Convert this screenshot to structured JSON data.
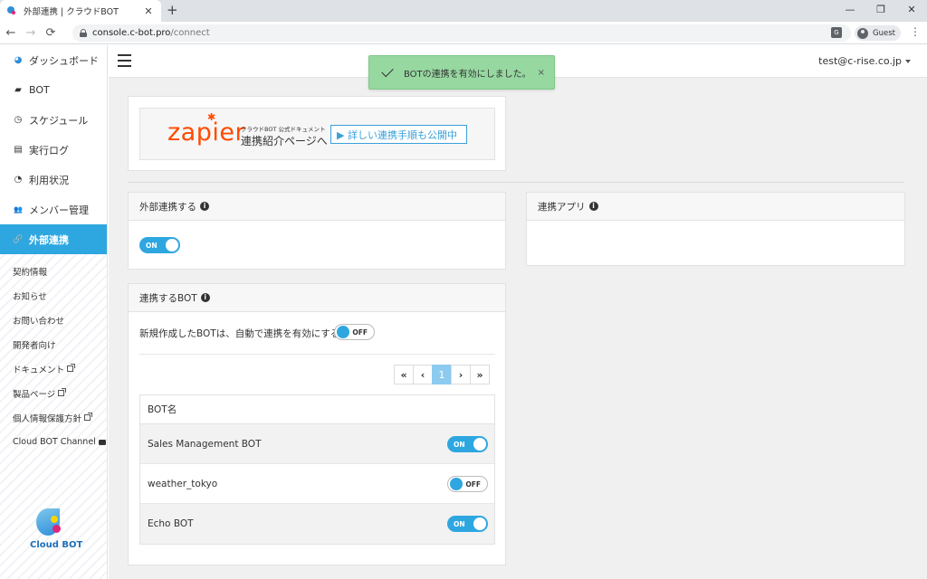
{
  "browser": {
    "tab_title": "外部連携 | クラウドBOT",
    "tab_close": "✕",
    "new_tab": "+",
    "window_min": "—",
    "window_restore": "❐",
    "window_close": "✕",
    "back": "←",
    "forward": "→",
    "reload": "⟳",
    "url_host": "console.c-bot.pro",
    "url_path": "/connect",
    "translate": "G",
    "profile": "Guest",
    "menu": "⋮"
  },
  "sidebar": {
    "items": [
      {
        "label": "ダッシュボード",
        "icon": "logo-icon",
        "glyph": "◕"
      },
      {
        "label": "BOT",
        "icon": "robot-icon",
        "glyph": "▰"
      },
      {
        "label": "スケジュール",
        "icon": "clock-icon",
        "glyph": "◷"
      },
      {
        "label": "実行ログ",
        "icon": "file-icon",
        "glyph": "▤"
      },
      {
        "label": "利用状況",
        "icon": "pie-chart-icon",
        "glyph": "◔"
      },
      {
        "label": "メンバー管理",
        "icon": "users-icon",
        "glyph": "👥"
      },
      {
        "label": "外部連携",
        "icon": "link-icon",
        "glyph": "🔗"
      }
    ],
    "sub_items": [
      {
        "label": "契約情報"
      },
      {
        "label": "お知らせ"
      },
      {
        "label": "お問い合わせ"
      },
      {
        "label": "開発者向け"
      },
      {
        "label": "ドキュメント"
      },
      {
        "label": "製品ページ"
      },
      {
        "label": "個人情報保護方針"
      },
      {
        "label": "Cloud BOT Channel"
      }
    ],
    "logo_text": "Cloud BOT"
  },
  "header": {
    "user_email": "test@c-rise.co.jp"
  },
  "toast": {
    "message": "BOTの連携を有効にしました。",
    "close": "×"
  },
  "banner": {
    "brand": "zapier",
    "star": "✱",
    "small_text": "クラウドBOT 公式ドキュメント",
    "big_text": "連携紹介ページへ",
    "button_text": "▶ 詳しい連携手順も公開中"
  },
  "external": {
    "title": "外部連携する",
    "info": "i",
    "toggle_label": "ON"
  },
  "apps": {
    "title": "連携アプリ",
    "info": "i"
  },
  "bots": {
    "title": "連携するBOT",
    "info": "i",
    "auto_text": "新規作成したBOTは、自動で連携を有効にする",
    "auto_toggle": "OFF",
    "pager": [
      "«",
      "‹",
      "1",
      "›",
      "»"
    ],
    "column_header": "BOT名",
    "rows": [
      {
        "name": "Sales Management BOT",
        "toggle": "ON",
        "on": true
      },
      {
        "name": "weather_tokyo",
        "toggle": "OFF",
        "on": false
      },
      {
        "name": "Echo BOT",
        "toggle": "ON",
        "on": true
      }
    ]
  }
}
